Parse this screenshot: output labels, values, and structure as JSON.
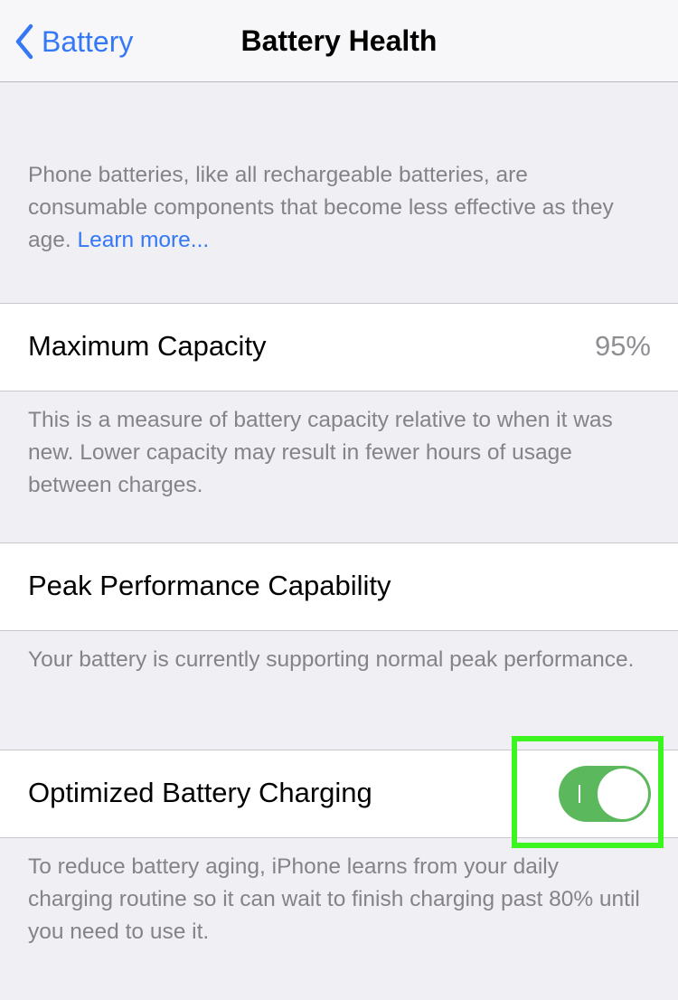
{
  "navbar": {
    "back_label": "Battery",
    "title": "Battery Health"
  },
  "intro": {
    "text": "Phone batteries, like all rechargeable batteries, are consumable components that become less effective as they age. ",
    "link": "Learn more..."
  },
  "max_capacity": {
    "label": "Maximum Capacity",
    "value": "95%",
    "footer": "This is a measure of battery capacity relative to when it was new. Lower capacity may result in fewer hours of usage between charges."
  },
  "peak_performance": {
    "label": "Peak Performance Capability",
    "footer": "Your battery is currently supporting normal peak performance."
  },
  "optimized_charging": {
    "label": "Optimized Battery Charging",
    "enabled": true,
    "footer": "To reduce battery aging, iPhone learns from your daily charging routine so it can wait to finish charging past 80% until you need to use it."
  },
  "colors": {
    "accent": "#3478f6",
    "toggle_on": "#5cb85c",
    "highlight": "#3cf520"
  }
}
